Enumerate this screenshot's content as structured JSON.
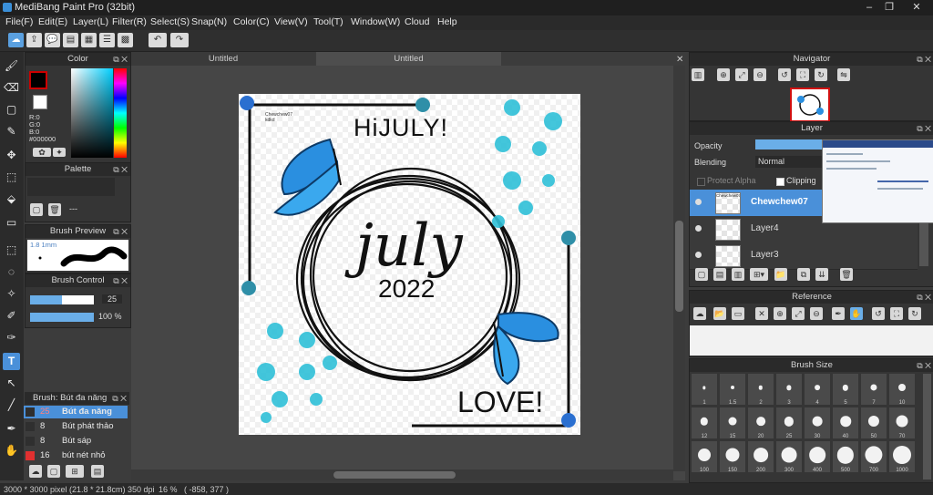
{
  "window": {
    "title": "MediBang Paint Pro (32bit)"
  },
  "menu": [
    "File(F)",
    "Edit(E)",
    "Layer(L)",
    "Filter(R)",
    "Select(S)",
    "Snap(N)",
    "Color(C)",
    "View(V)",
    "Tool(T)",
    "Window(W)",
    "Cloud",
    "Help"
  ],
  "tabs": [
    {
      "label": "Untitled"
    },
    {
      "label": "Untitled"
    }
  ],
  "color_panel": {
    "title": "Color",
    "r": "R:0",
    "g": "G:0",
    "b": "B:0",
    "hex": "#000000",
    "fg": "#000000",
    "bg": "#ffffff",
    "fg_border": "#cc0000"
  },
  "palette_panel": {
    "title": "Palette",
    "dash": "---"
  },
  "brush_preview": {
    "title": "Brush Preview",
    "size": "1.8 1mm"
  },
  "brush_control": {
    "title": "Brush Control",
    "size": "25",
    "opacity": "100 %",
    "size_fraction": 0.5,
    "opacity_fraction": 1.0
  },
  "brush_list": {
    "title": "Brush: Bút đa năng",
    "items": [
      {
        "size": "25",
        "name": "Bút đa năng",
        "color": "#2f2f2f",
        "selected": true
      },
      {
        "size": "8",
        "name": "Bút phát thảo",
        "color": "#2f2f2f",
        "selected": false
      },
      {
        "size": "8",
        "name": "Bút sáp",
        "color": "#2f2f2f",
        "selected": false
      },
      {
        "size": "16",
        "name": "bút nét nhỏ",
        "color": "#e03030",
        "selected": false
      }
    ]
  },
  "navigator": {
    "title": "Navigator"
  },
  "layer_panel": {
    "title": "Layer",
    "opacity_label": "Opacity",
    "blending_label": "Blending",
    "blending_value": "Normal",
    "protect_alpha": "Protect Alpha",
    "clipping": "Clipping",
    "layers": [
      {
        "name": "Chewchew07",
        "thumb_text": "Chewchew07",
        "selected": true
      },
      {
        "name": "Layer4",
        "thumb_text": "",
        "selected": false
      },
      {
        "name": "Layer3",
        "thumb_text": "",
        "selected": false
      }
    ]
  },
  "reference": {
    "title": "Reference"
  },
  "brush_size": {
    "title": "Brush Size",
    "sizes": [
      "1",
      "1.5",
      "2",
      "3",
      "4",
      "5",
      "7",
      "10",
      "12",
      "15",
      "20",
      "25",
      "30",
      "40",
      "50",
      "70",
      "100",
      "150",
      "200",
      "300",
      "400",
      "500",
      "700",
      "1000"
    ]
  },
  "artwork": {
    "credit_line1": "Chewchew07",
    "credit_line2": "kdkd",
    "hijuly": "HiJULY!",
    "july": "july",
    "year": "2022",
    "love": "LOVE!"
  },
  "status": {
    "dimensions": "3000 * 3000 pixel",
    "physical": "(21.8 * 21.8cm)",
    "dpi": "350 dpi",
    "zoom": "16 %",
    "coords": "( -858, 377 )"
  },
  "colors": {
    "accent": "#4a90d9",
    "handle": "#2a6fd0",
    "handle_alt": "#2f8fa8",
    "butterfly": "#2a8fe0",
    "flower": "#2fc0d8"
  }
}
